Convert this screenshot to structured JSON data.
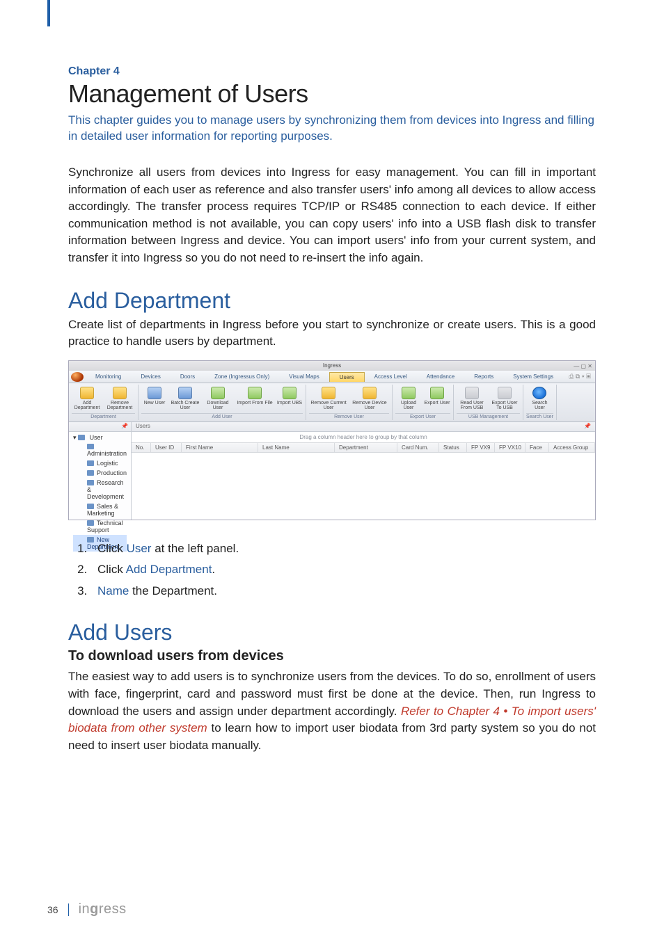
{
  "chapter_label": "Chapter 4",
  "title": "Management of Users",
  "intro": "This chapter guides you to manage users by synchronizing them from devices into Ingress and filling in detailed user information for reporting purposes.",
  "body1": "Synchronize all users from devices into Ingress for easy management. You can fill in important information of each user as reference and also transfer users' info among all devices to allow access accordingly. The transfer process requires TCP/IP or RS485 connection to each device. If either communication method is not available, you can copy users' info into a USB flash disk to transfer information between Ingress and device. You can import users' info from your current system, and transfer it into Ingress so you do not need to re-insert the info again.",
  "section1": {
    "heading": "Add Department",
    "desc": "Create list of departments in Ingress before you start to synchronize or create users. This is a good practice to handle users by department."
  },
  "screenshot": {
    "window_title": "Ingress",
    "tabs": [
      "Monitoring",
      "Devices",
      "Doors",
      "Zone (Ingressus Only)",
      "Visual Maps",
      "Users",
      "Access Level",
      "Attendance",
      "Reports",
      "System Settings"
    ],
    "active_tab": "Users",
    "ribbon": [
      {
        "label": "Department",
        "items": [
          {
            "name": "Add Department",
            "icon": "ic-yellow"
          },
          {
            "name": "Remove Department",
            "icon": "ic-yellow"
          }
        ]
      },
      {
        "label": "Add User",
        "items": [
          {
            "name": "New User",
            "icon": "ic-blue",
            "w": "w38"
          },
          {
            "name": "Batch Create User",
            "icon": "ic-blue"
          },
          {
            "name": "Download User",
            "icon": "ic-green"
          },
          {
            "name": "Import From File",
            "icon": "ic-green",
            "w": "w56"
          },
          {
            "name": "Import UBS",
            "icon": "ic-green",
            "w": "w38"
          }
        ]
      },
      {
        "label": "Remove User",
        "items": [
          {
            "name": "Remove Current User",
            "icon": "ic-yellow",
            "w": "w56"
          },
          {
            "name": "Remove Device User",
            "icon": "ic-yellow",
            "w": "w56"
          }
        ]
      },
      {
        "label": "Export User",
        "items": [
          {
            "name": "Upload User",
            "icon": "ic-green",
            "w": "w38"
          },
          {
            "name": "Export User",
            "icon": "ic-green",
            "w": "w38"
          }
        ]
      },
      {
        "label": "USB Management",
        "items": [
          {
            "name": "Read User From USB",
            "icon": "ic-grey"
          },
          {
            "name": "Export User To USB",
            "icon": "ic-grey"
          }
        ]
      },
      {
        "label": "Search User",
        "items": [
          {
            "name": "Search User",
            "icon": "ic-search",
            "w": "w38"
          }
        ]
      }
    ],
    "tree_root": "User",
    "tree_items": [
      "Administration",
      "Logistic",
      "Production",
      "Research & Development",
      "Sales & Marketing",
      "Technical Support",
      "New Department"
    ],
    "tree_selected": "New Department",
    "main_panel_title": "Users",
    "drag_hint": "Drag a column header here to group by that column",
    "columns": [
      "No.",
      "User ID",
      "First Name",
      "Last Name",
      "Department",
      "Card Num.",
      "Status",
      "FP VX9",
      "FP VX10",
      "Face",
      "Access Group"
    ]
  },
  "steps": [
    {
      "pre": "Click ",
      "link": "User",
      "post": " at the left panel."
    },
    {
      "pre": "Click ",
      "link": "Add Department",
      "post": "."
    },
    {
      "pre": "",
      "link": "Name",
      "post": " the Department."
    }
  ],
  "section2": {
    "heading": "Add Users",
    "subheading": "To download users from devices",
    "para_a": "The easiest way to add users is to synchronize users from the devices. To do so, enrollment of users with face, fingerprint, card and password must first be done at the device. Then, run Ingress to download the users and assign under department accordingly. ",
    "ref": "Refer to Chapter 4 • To import users' biodata from other system",
    "para_b": " to learn how to import user biodata from 3rd party system so you do not need to insert user biodata manually."
  },
  "footer": {
    "page": "36",
    "brand_pre": "in",
    "brand_g": "g",
    "brand_post": "ress"
  }
}
